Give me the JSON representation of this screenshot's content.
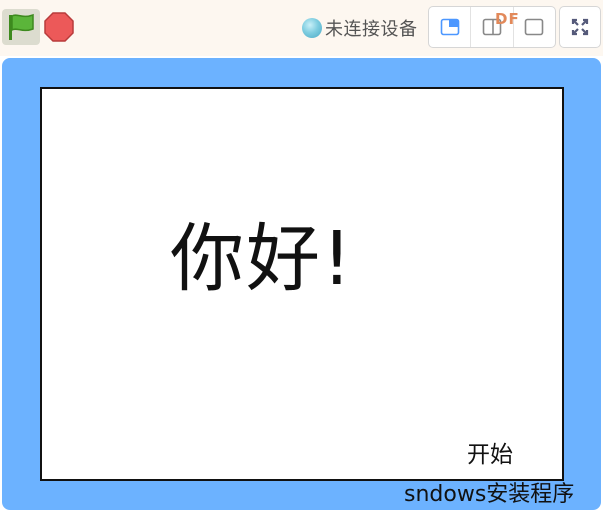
{
  "toolbar": {
    "green_flag_icon": "green-flag-icon",
    "stop_icon": "stop-icon",
    "connection_status": "未连接设备",
    "brand_text": "DF",
    "layout_icons": [
      "small-stage-icon",
      "normal-stage-icon",
      "large-stage-icon"
    ],
    "fullscreen_icon": "fullscreen-icon"
  },
  "stage": {
    "greeting": "你好!",
    "start_label": "开始",
    "frame_color": "#6cb2ff"
  },
  "overlay": {
    "taskbar_text": "sndows安装程序"
  }
}
